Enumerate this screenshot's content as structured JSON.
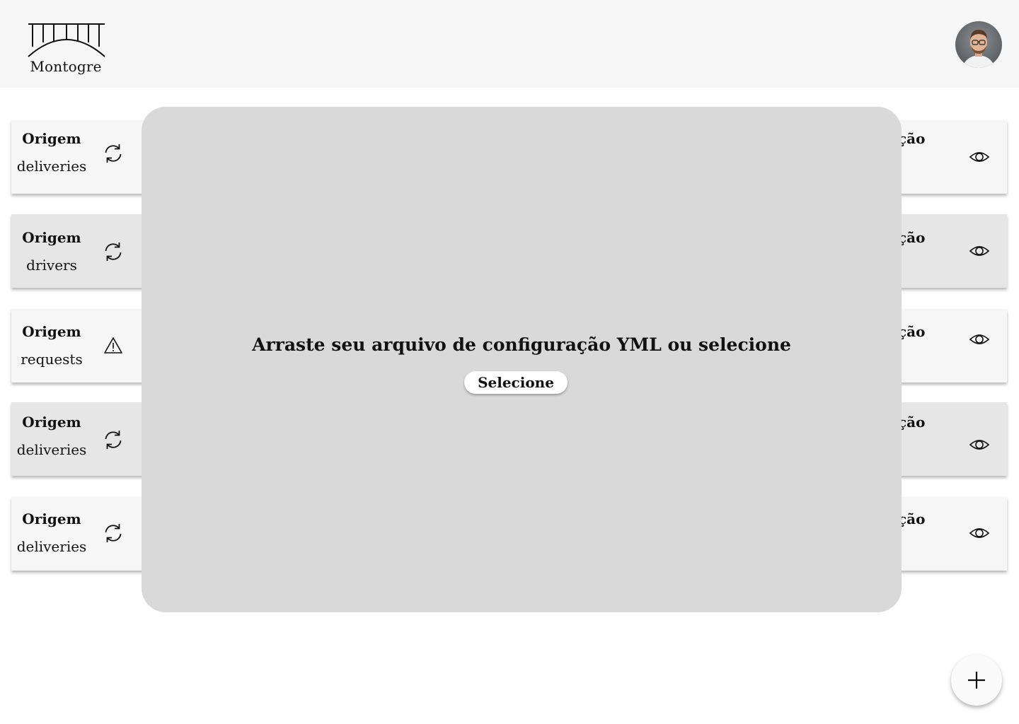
{
  "header": {
    "logo_text": "Montogre"
  },
  "rows": [
    {
      "origin_label": "Origem",
      "origin_value": "deliveries",
      "status_icon": "refresh-icon",
      "destination_label_visible": "ação"
    },
    {
      "origin_label": "Origem",
      "origin_value": "drivers",
      "status_icon": "refresh-icon",
      "destination_label_visible": "ação"
    },
    {
      "origin_label": "Origem",
      "origin_value": "requests",
      "status_icon": "warning-icon",
      "destination_label_visible": "ação"
    },
    {
      "origin_label": "Origem",
      "origin_value": "deliveries",
      "status_icon": "refresh-icon",
      "destination_label_visible": "ação"
    },
    {
      "origin_label": "Origem",
      "origin_value": "deliveries",
      "status_icon": "refresh-icon",
      "destination_label_visible": "ação"
    }
  ],
  "modal": {
    "title": "Arraste seu arquivo de configuração YML ou selecione",
    "select_label": "Selecione"
  },
  "colors": {
    "header_bg": "#f6f6f6",
    "row_bg_light": "#f6f6f6",
    "row_bg_dark": "#e6e6e6",
    "modal_bg": "#d9d9d9"
  }
}
